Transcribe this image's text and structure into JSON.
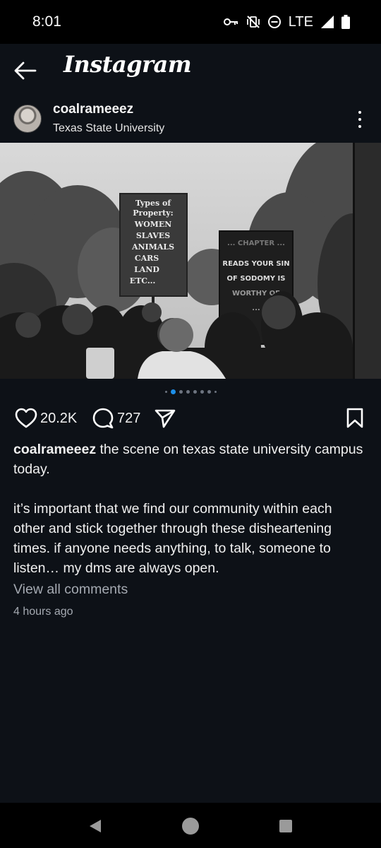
{
  "status_bar": {
    "time": "8:01",
    "network": "LTE",
    "icons": [
      "vpn-key-icon",
      "vibrate-off-icon",
      "do-not-disturb-icon",
      "signal-icon",
      "battery-icon"
    ]
  },
  "app_header": {
    "title": "Instagram",
    "back_icon": "arrow-left-icon"
  },
  "post": {
    "username": "coalrameeez",
    "location": "Texas State University",
    "photo": {
      "sign1_lines": [
        "Types of",
        "Property:",
        "WOMEN",
        "SLAVES",
        "ANIMALS",
        "CARS",
        "LAND",
        "ETC..."
      ],
      "sign2_lines": [
        "... CHAPTER ...",
        "READS YOUR SIN",
        "OF SODOMY IS",
        "WORTHY OF",
        "..."
      ]
    },
    "carousel": {
      "count": 8,
      "active_index": 1
    },
    "likes": "20.2K",
    "comments": "727",
    "caption_user": "coalrameeez",
    "caption_line1": "the scene on texas state university campus today.",
    "caption_para2": "it’s important that we find our community within each other and stick together through these disheartening times. if anyone needs anything, to talk, someone to listen… my dms are always open.",
    "view_comments": "View all comments",
    "timestamp": "4 hours ago"
  },
  "colors": {
    "background": "#0d1117",
    "status_bar": "#000000",
    "accent_dot": "#1d8fe8",
    "muted_text": "#a4a9b1"
  }
}
